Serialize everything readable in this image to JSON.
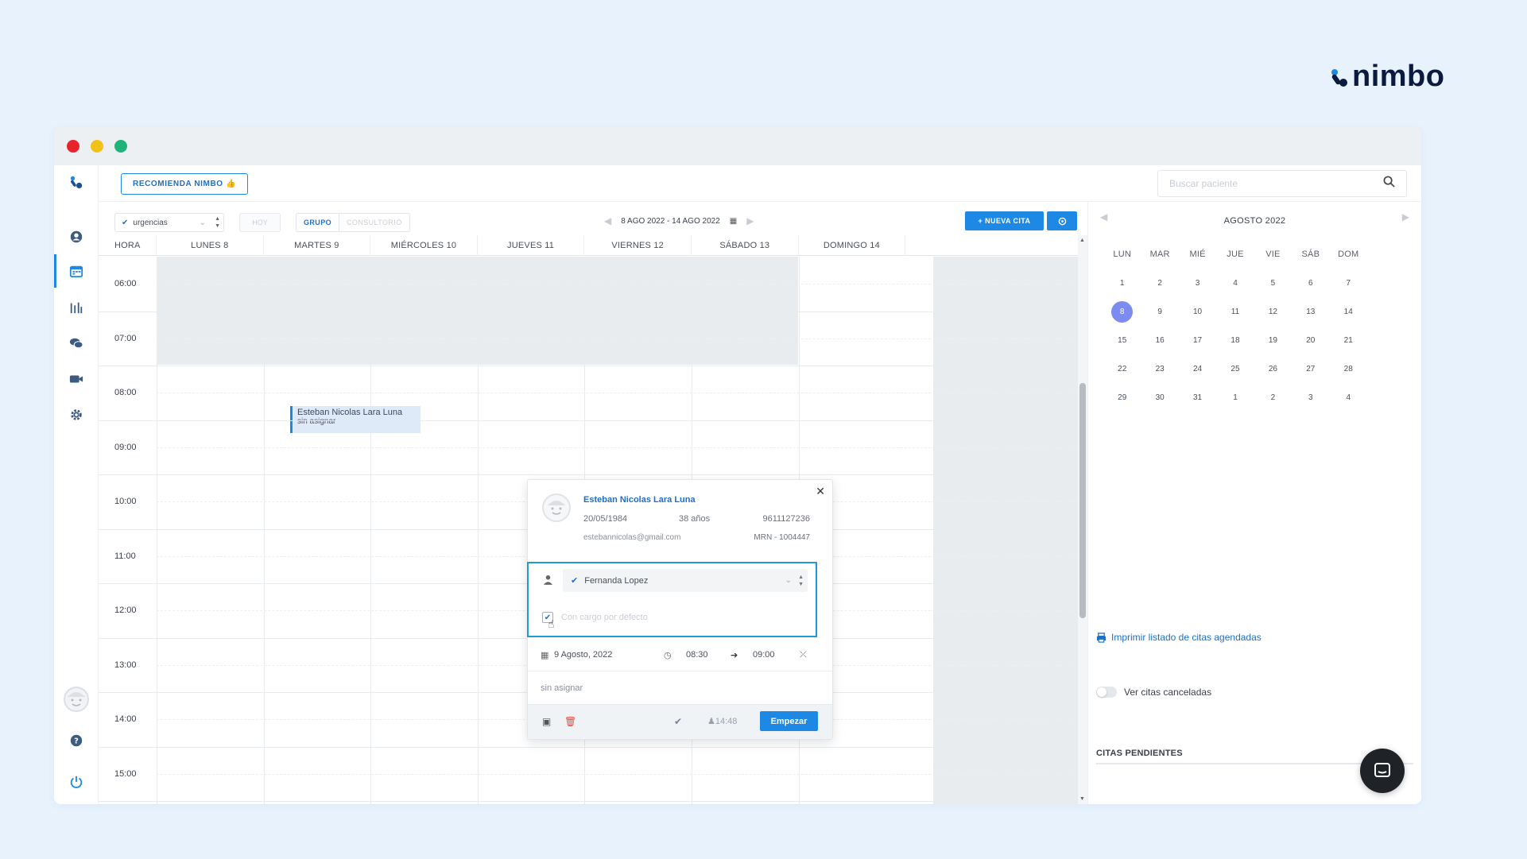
{
  "brand": {
    "name": "nimbo",
    "color": "#0b1b3f",
    "accent": "#1e88e5"
  },
  "topbar": {
    "recommend_label": "RECOMIENDA NIMBO 👍",
    "search_placeholder": "Buscar paciente"
  },
  "sidebar": {
    "items": [
      {
        "icon": "patients-icon"
      },
      {
        "icon": "calendar-icon",
        "active": true
      },
      {
        "icon": "stats-icon"
      },
      {
        "icon": "chat-icon"
      },
      {
        "icon": "video-icon"
      },
      {
        "icon": "gear-icon"
      }
    ],
    "bottom": [
      {
        "icon": "avatar"
      },
      {
        "icon": "help-icon"
      },
      {
        "icon": "power-icon"
      }
    ]
  },
  "toolbar": {
    "filter_value": "urgencias",
    "today_label": "HOY",
    "group_label": "GRUPO",
    "office_label": "CONSULTORIO",
    "week_range": "8 AGO 2022 - 14 AGO 2022",
    "new_label": "+ NUEVA CITA"
  },
  "grid": {
    "hour_header": "HORA",
    "days": [
      "LUNES 8",
      "MARTES 9",
      "MIÉRCOLES 10",
      "JUEVES 11",
      "VIERNES 12",
      "SÁBADO 13",
      "DOMINGO 14"
    ],
    "hours": [
      "06:00",
      "07:00",
      "08:00",
      "09:00",
      "10:00",
      "11:00",
      "12:00",
      "13:00",
      "14:00",
      "15:00"
    ]
  },
  "event": {
    "title": "Esteban Nicolas Lara Luna",
    "subtitle": "sin asignar"
  },
  "popover": {
    "name": "Esteban Nicolas Lara Luna",
    "dob": "20/05/1984",
    "age": "38 años",
    "phone": "9611127236",
    "email": "estebannicolas@gmail.com",
    "mrn": "MRN - 1004447",
    "doctor": "Fernanda Lopez",
    "charge_label": "Con cargo por defecto",
    "date": "9 Agosto, 2022",
    "start_time": "08:30",
    "end_time": "09:00",
    "note": "sin asignar",
    "time_badge": "14:48",
    "start_label": "Empezar"
  },
  "minical": {
    "month": "AGOSTO 2022",
    "dow": [
      "LUN",
      "MAR",
      "MIÉ",
      "JUE",
      "VIE",
      "SÁB",
      "DOM"
    ],
    "weeks": [
      [
        "1",
        "2",
        "3",
        "4",
        "5",
        "6",
        "7"
      ],
      [
        "8",
        "9",
        "10",
        "11",
        "12",
        "13",
        "14"
      ],
      [
        "15",
        "16",
        "17",
        "18",
        "19",
        "20",
        "21"
      ],
      [
        "22",
        "23",
        "24",
        "25",
        "26",
        "27",
        "28"
      ],
      [
        "29",
        "30",
        "31",
        "1",
        "2",
        "3",
        "4"
      ]
    ],
    "selected": "8"
  },
  "side_panel": {
    "print_label": "Imprimir listado de citas agendadas",
    "cancelled_label": "Ver citas canceladas",
    "pending_title": "CITAS PENDIENTES"
  }
}
